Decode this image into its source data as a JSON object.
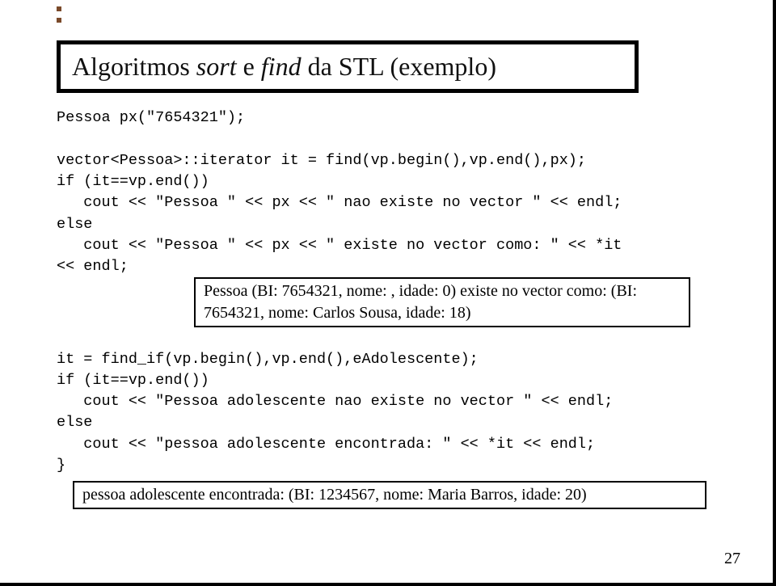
{
  "title": {
    "prefix": "Algoritmos ",
    "italic1": "sort",
    "mid": " e ",
    "italic2": "find",
    "suffix": " da STL (exemplo)"
  },
  "code": {
    "l1": "Pessoa px(\"7654321\");",
    "l2": "",
    "l3": "vector<Pessoa>::iterator it = find(vp.begin(),vp.end(),px);",
    "l4": "if (it==vp.end())",
    "l5": "   cout << \"Pessoa \" << px << \" nao existe no vector \" << endl;",
    "l6": "else",
    "l7": "   cout << \"Pessoa \" << px << \" existe no vector como: \" << *it",
    "l8": "<< endl;",
    "out1": "Pessoa (BI: 7654321, nome: , idade: 0) existe no vector como: (BI: 7654321, nome: Carlos Sousa, idade: 18)",
    "l9": "",
    "l10": "it = find_if(vp.begin(),vp.end(),eAdolescente);",
    "l11": "if (it==vp.end())",
    "l12": "   cout << \"Pessoa adolescente nao existe no vector \" << endl;",
    "l13": "else",
    "l14": "   cout << \"pessoa adolescente encontrada: \" << *it << endl;",
    "l15": "}",
    "out2": "pessoa adolescente encontrada: (BI: 1234567, nome: Maria Barros, idade: 20)"
  },
  "page_number": "27"
}
